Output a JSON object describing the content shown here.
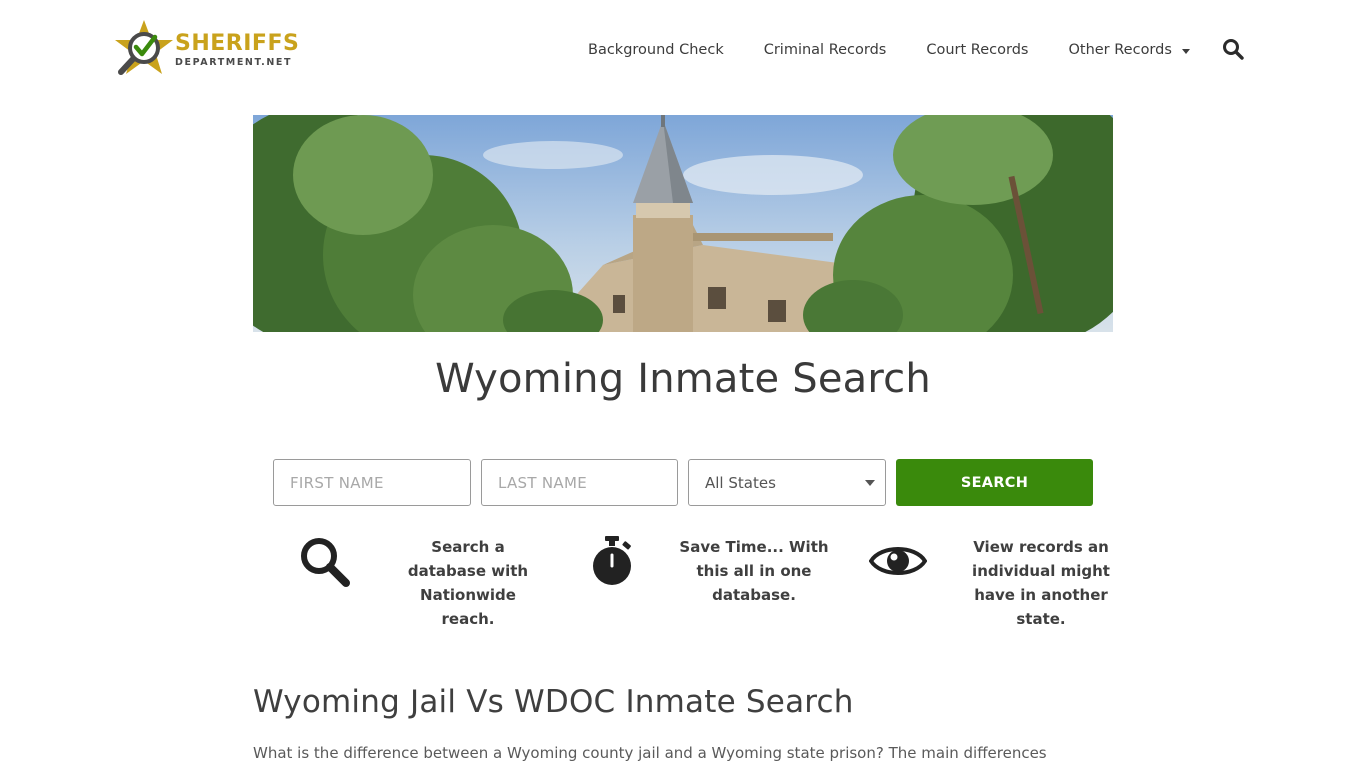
{
  "logo": {
    "main": "SHERIFFS",
    "sub": "DEPARTMENT.NET",
    "colors": {
      "gold": "#c9a21c",
      "check": "#3a8a0c",
      "dark": "#4a4a4a"
    }
  },
  "nav": {
    "items": [
      "Background Check",
      "Criminal Records",
      "Court Records",
      "Other Records"
    ],
    "search_icon": "search-icon"
  },
  "hero": {
    "alt": "historic stone building turret among trees"
  },
  "page": {
    "title": "Wyoming Inmate Search"
  },
  "form": {
    "first_placeholder": "FIRST NAME",
    "last_placeholder": "LAST NAME",
    "state_value": "All States",
    "button_label": "SEARCH",
    "button_color": "#3a8a0c"
  },
  "features": [
    {
      "icon": "search-icon",
      "text": "Search a database with Nationwide reach."
    },
    {
      "icon": "stopwatch-icon",
      "text": "Save Time... With this all in one database."
    },
    {
      "icon": "eye-icon",
      "text": "View records an individual might have in another state."
    }
  ],
  "section": {
    "heading": "Wyoming Jail Vs WDOC Inmate Search",
    "paragraph": "What is the difference between a Wyoming county jail and a Wyoming state prison? The main differences"
  }
}
